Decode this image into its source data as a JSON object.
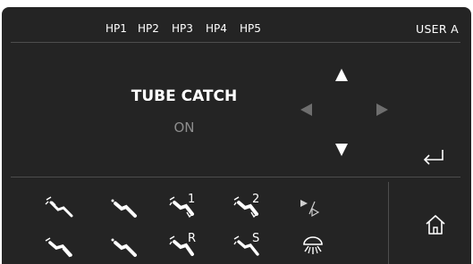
{
  "header": {
    "handpieces": [
      "HP1",
      "HP2",
      "HP3",
      "HP4",
      "HP5"
    ],
    "user": "USER A"
  },
  "main": {
    "setting_name": "TUBE CATCH",
    "setting_value": "ON"
  },
  "navigation": {
    "icons": [
      "arrow-up-icon",
      "arrow-left-icon",
      "arrow-right-icon",
      "arrow-down-icon",
      "enter-icon"
    ],
    "dimmed_color": "#6e6e6e"
  },
  "tools": {
    "row1": [
      {
        "icon": "instrument-1-icon",
        "label": ""
      },
      {
        "icon": "instrument-2-icon",
        "label": ""
      },
      {
        "icon": "instrument-program-1-icon",
        "label": "1"
      },
      {
        "icon": "instrument-program-2-icon",
        "label": "2"
      },
      {
        "icon": "play-forward-icon",
        "label": ""
      }
    ],
    "row2": [
      {
        "icon": "instrument-3-icon",
        "label": ""
      },
      {
        "icon": "instrument-4-icon",
        "label": ""
      },
      {
        "icon": "instrument-reverse-icon",
        "label": "R"
      },
      {
        "icon": "instrument-start-icon",
        "label": "S"
      },
      {
        "icon": "operating-light-icon",
        "label": ""
      }
    ],
    "home_icon": "home-icon"
  },
  "colors": {
    "background": "#242424",
    "divider": "#4d4d4d",
    "text": "#ffffff",
    "value_text": "#8c8c8c"
  }
}
